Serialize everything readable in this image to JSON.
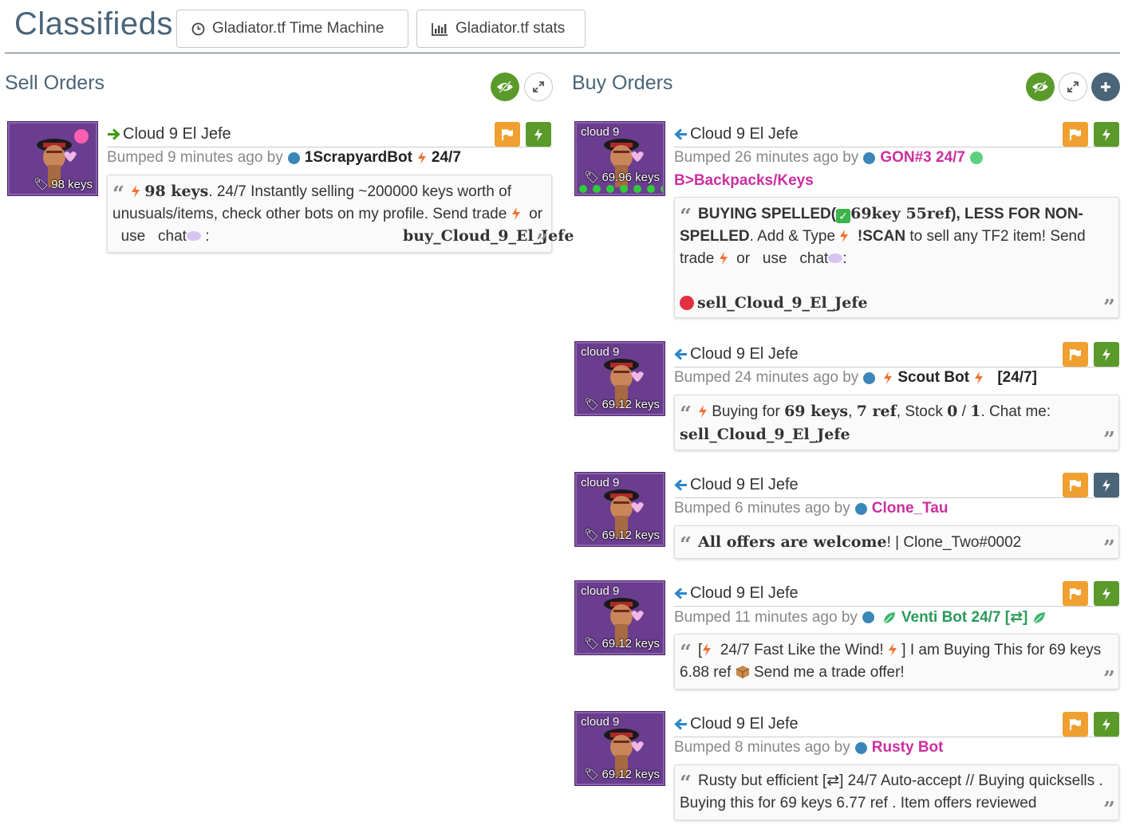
{
  "header": {
    "title": "Classifieds",
    "btn_time_machine": "Gladiator.tf Time Machine",
    "btn_stats": "Gladiator.tf stats"
  },
  "sell": {
    "heading": "Sell Orders",
    "listing": {
      "name": "Cloud 9 El Jefe",
      "price": "98 keys",
      "bumped": "Bumped 9 minutes ago by",
      "user": "1ScrapyardBot",
      "user_suffix": "24/7",
      "q_strong": "98 keys",
      "q_text1": ". 24/7 Instantly selling ~200000 keys worth of unusuals/items, check other bots on my profile. Send",
      "q_trade": "trade",
      "q_or": "or",
      "q_use": "use",
      "q_chat": "chat",
      "q_colon": ":",
      "q_cmd": "buy_Cloud_9_El_Jefe"
    }
  },
  "buy": {
    "heading": "Buy Orders",
    "listings": [
      {
        "name": "Cloud 9 El Jefe",
        "craft": "cloud 9",
        "price": "69.96 keys",
        "bumped": "Bumped 26 minutes ago by",
        "user": "GON#3 24/7",
        "ribbon": "B>Backpacks/Keys",
        "q_a": "BUYING SPELLED(",
        "q_b": "69key 55ref",
        "q_c": "), LESS FOR NON-SPELLED",
        "q_d": ". Add & Type",
        "q_e": "!SCAN",
        "q_f": "to sell any TF2 item! Send",
        "q_trade": "trade",
        "q_or": "or",
        "q_use": "use",
        "q_chat": "chat",
        "q_colon": ":",
        "q_cmd": "sell_Cloud_9_El_Jefe"
      },
      {
        "name": "Cloud 9 El Jefe",
        "craft": "cloud 9",
        "price": "69.12 keys",
        "bumped": "Bumped 24 minutes ago by",
        "user": "Scout Bot",
        "user_suffix": "[24/7]",
        "q_a": "Buying for",
        "q_b": "69 keys",
        "q_c": ",",
        "q_d": "7 ref",
        "q_e": ", Stock",
        "q_f": "0",
        "q_g": "/",
        "q_h": "1",
        "q_i": ". Chat me:",
        "q_cmd": "sell_Cloud_9_El_Jefe"
      },
      {
        "name": "Cloud 9 El Jefe",
        "craft": "cloud 9",
        "price": "69.12 keys",
        "bumped": "Bumped 6 minutes ago by",
        "user": "Clone_Tau",
        "q_a": "All offers are welcome",
        "q_b": "! | Clone_Two#0002"
      },
      {
        "name": "Cloud 9 El Jefe",
        "craft": "cloud 9",
        "price": "69.12 keys",
        "bumped": "Bumped 11 minutes ago by",
        "user": "Venti Bot 24/7 [⇄]",
        "q_a": "[",
        "q_b": "24/7 Fast Like the Wind!",
        "q_c": "] I am Buying This for 69 keys 6.88 ref",
        "q_d": "Send me a trade offer!"
      },
      {
        "name": "Cloud 9 El Jefe",
        "craft": "cloud 9",
        "price": "69.12 keys",
        "bumped": "Bumped 8 minutes ago by",
        "user": "Rusty Bot",
        "q_a": "Rusty but efficient [⇄] 24/7 Auto-accept // Buying quicksells . Buying this for 69 keys 6.77 ref . Item offers reviewed"
      }
    ]
  },
  "colors": {
    "accent": "#4a6478",
    "green": "#5a9a2a",
    "orange": "#f0a030",
    "magenta": "#cc2fa0",
    "teal_green": "#2a9a5a",
    "thumb_purple": "#6a3d8f"
  }
}
